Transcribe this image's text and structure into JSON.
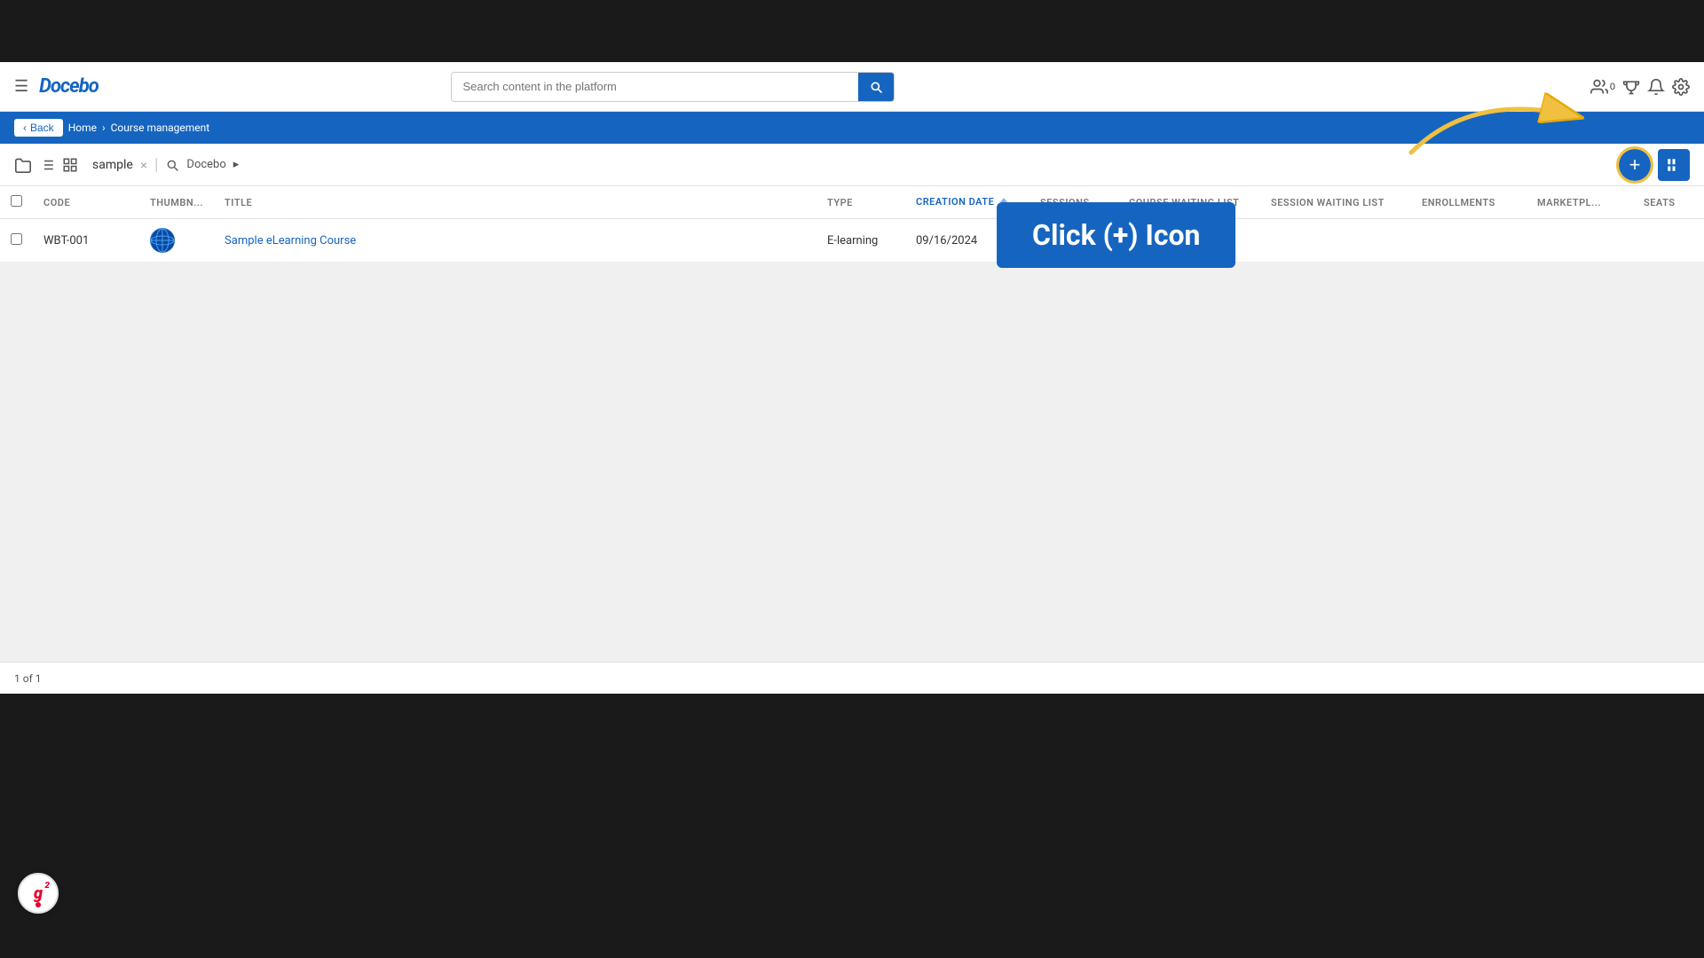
{
  "app": {
    "title": "Docebo"
  },
  "topbar": {
    "hamburger_label": "☰",
    "logo": "docebo",
    "search_placeholder": "Search content in the platform",
    "search_btn_label": "🔍",
    "icons": {
      "users_icon": "👤",
      "users_count": "0",
      "trophy_icon": "🏆",
      "bell_icon": "🔔",
      "settings_icon": "⚙"
    }
  },
  "breadcrumb": {
    "back_label": "Back",
    "home_label": "Home",
    "current_label": "Course management"
  },
  "toolbar": {
    "folder_icon": "📁",
    "list_icon": "≡",
    "grid_icon": "⊞",
    "folder_name": "sample",
    "clear_label": "×",
    "search_icon": "🔍",
    "catalog_label": "Docebo",
    "catalog_arrow": "▸",
    "add_btn_label": "+",
    "view_toggle_label": "⊞"
  },
  "table": {
    "columns": [
      {
        "key": "code",
        "label": "CODE",
        "sortable": false
      },
      {
        "key": "thumbnail",
        "label": "THUMBN...",
        "sortable": false
      },
      {
        "key": "title",
        "label": "TITLE",
        "sortable": false
      },
      {
        "key": "type",
        "label": "TYPE",
        "sortable": false
      },
      {
        "key": "creation_date",
        "label": "CREATION DATE",
        "sortable": true
      },
      {
        "key": "sessions",
        "label": "SESSIONS",
        "sortable": false
      },
      {
        "key": "course_waiting_list",
        "label": "COURSE WAITING LIST",
        "sortable": false
      },
      {
        "key": "session_waiting_list",
        "label": "SESSION WAITING LIST",
        "sortable": false
      },
      {
        "key": "enrollments",
        "label": "ENROLLMENTS",
        "sortable": false
      },
      {
        "key": "marketplace",
        "label": "MARKETPL...",
        "sortable": false
      },
      {
        "key": "seats",
        "label": "SEATS",
        "sortable": false
      }
    ],
    "rows": [
      {
        "code": "WBT-001",
        "thumbnail_type": "globe",
        "title": "Sample eLearning Course",
        "type": "E-learning",
        "creation_date": "09/16/2024",
        "sessions": "",
        "course_waiting_list": "",
        "session_waiting_list": "",
        "enrollments": "",
        "marketplace": "",
        "seats": ""
      }
    ]
  },
  "cta": {
    "label": "Click (+) Icon"
  },
  "pagination": {
    "label": "1 of 1"
  }
}
